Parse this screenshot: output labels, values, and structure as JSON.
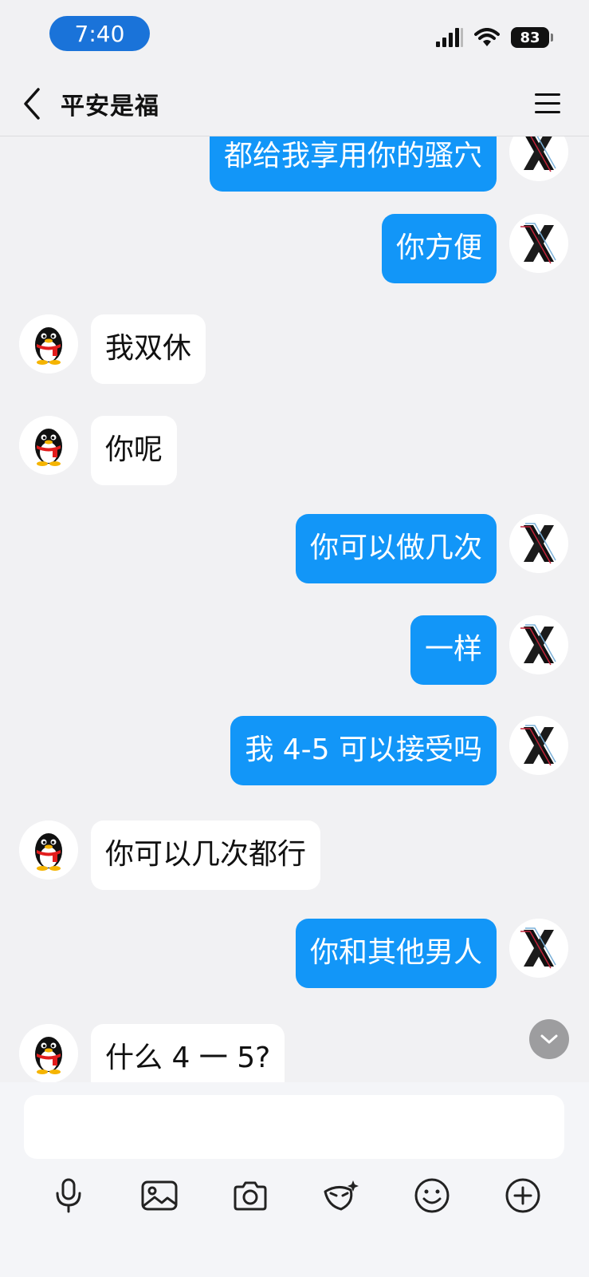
{
  "status_bar": {
    "time": "7:40",
    "battery": "83"
  },
  "header": {
    "title": "平安是福"
  },
  "messages": [
    {
      "dir": "out",
      "text": "都给我享用你的骚穴"
    },
    {
      "dir": "out",
      "text": "你方便"
    },
    {
      "dir": "in",
      "text": "我双休"
    },
    {
      "dir": "in",
      "text": "你呢"
    },
    {
      "dir": "out",
      "text": "你可以做几次"
    },
    {
      "dir": "out",
      "text": "一样"
    },
    {
      "dir": "out",
      "text": "我 4-5 可以接受吗"
    },
    {
      "dir": "in",
      "text": "你可以几次都行"
    },
    {
      "dir": "out",
      "text": "你和其他男人"
    },
    {
      "dir": "in",
      "text": "什么 4 一 5?"
    }
  ],
  "icons": {
    "back": "chevron-left-icon",
    "menu": "hamburger-menu-icon",
    "scroll": "chevron-down-icon",
    "toolbar": [
      "microphone-icon",
      "image-icon",
      "camera-icon",
      "sticker-icon",
      "emoji-icon",
      "add-icon"
    ]
  },
  "colors": {
    "outgoing_bubble": "#1296f8",
    "incoming_bubble": "#ffffff",
    "background": "#f1f1f3",
    "time_pill": "#1a73d9"
  }
}
